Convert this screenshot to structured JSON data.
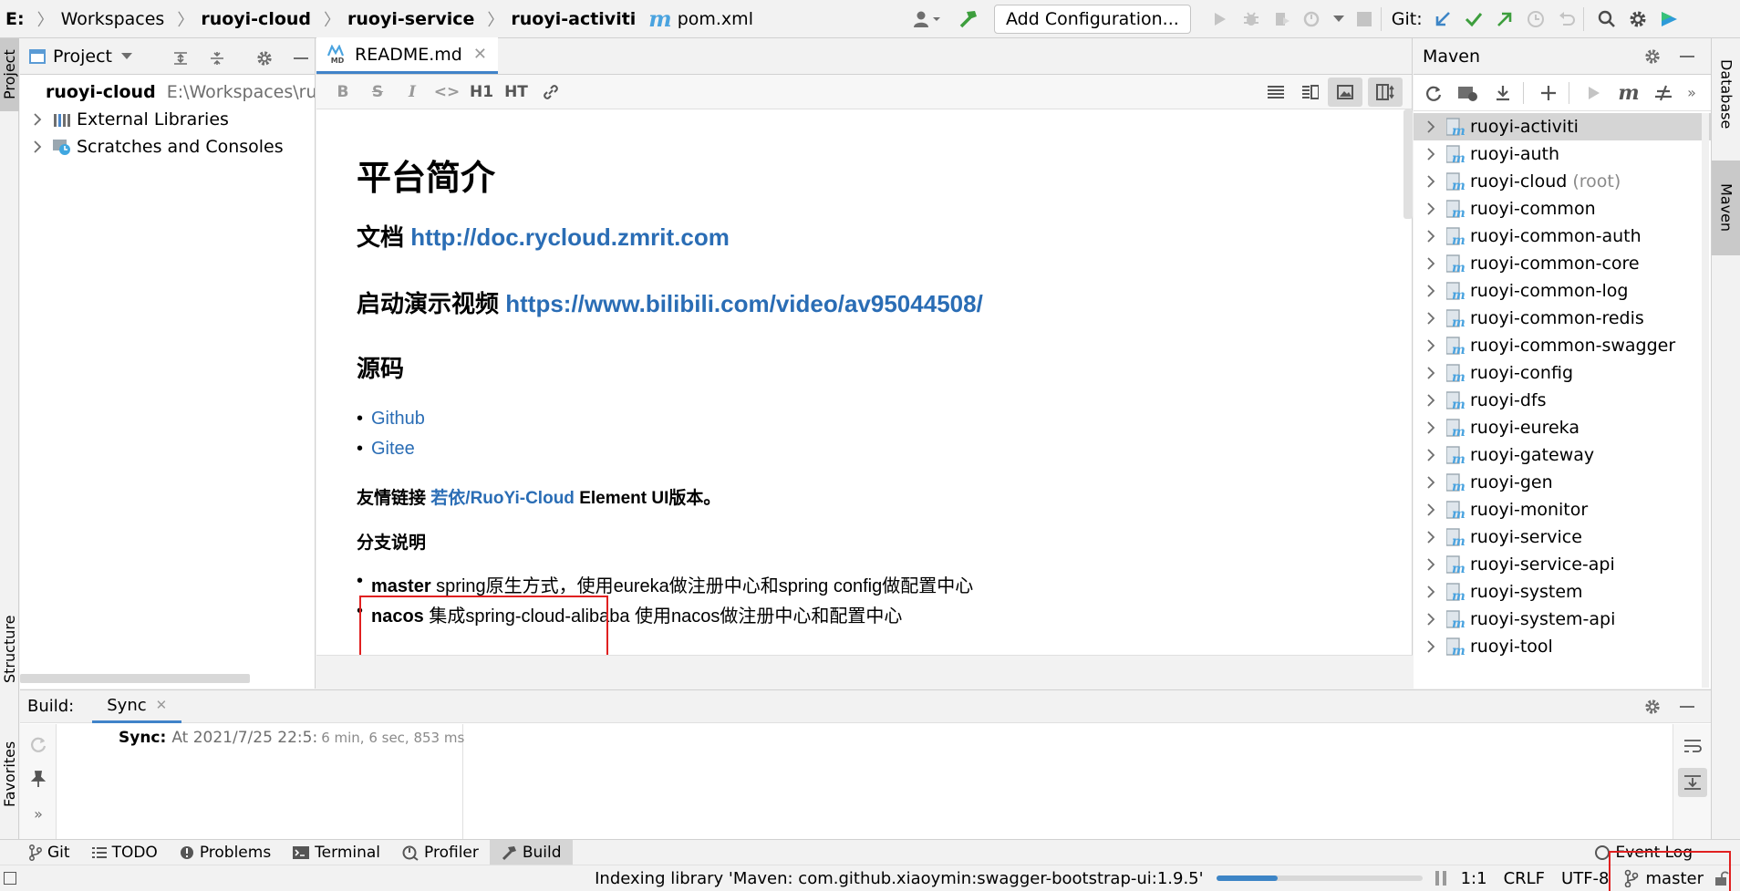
{
  "breadcrumbs": [
    {
      "label": "E:",
      "bold": true
    },
    {
      "label": "Workspaces",
      "bold": false
    },
    {
      "label": "ruoyi-cloud",
      "bold": true
    },
    {
      "label": "ruoyi-service",
      "bold": true
    },
    {
      "label": "ruoyi-activiti",
      "bold": true
    }
  ],
  "current_file": "pom.xml",
  "toolbar": {
    "add_configuration": "Add Configuration...",
    "git_label": "Git:"
  },
  "left_stripe": {
    "project": "Project",
    "structure": "Structure",
    "favorites": "Favorites"
  },
  "right_stripe": {
    "database": "Database",
    "maven": "Maven"
  },
  "project_panel": {
    "title": "Project",
    "items": [
      {
        "label": "ruoyi-cloud",
        "path": "E:\\Workspaces\\ru"
      },
      {
        "label": "External Libraries"
      },
      {
        "label": "Scratches and Consoles"
      }
    ]
  },
  "editor": {
    "tab_label": "README.md",
    "tab_badge": "MD",
    "toolbar_labels": {
      "h1": "H1",
      "ht": "HT"
    },
    "content": {
      "h1": "平台简介",
      "doc_label": "文档",
      "doc_link": "http://doc.rycloud.zmrit.com",
      "video_label": "启动演示视频",
      "video_link": "https://www.bilibili.com/video/av95044508/",
      "source_heading": "源码",
      "source_links": [
        "Github",
        "Gitee"
      ],
      "friend_prefix": "友情链接",
      "friend_link": "若依/RuoYi-Cloud",
      "friend_suffix": "Element UI版本。",
      "branch_heading": "分支说明",
      "branches": [
        {
          "name": "master",
          "desc": "spring原生方式，使用eureka做注册中心和spring config做配置中心"
        },
        {
          "name": "nacos",
          "desc": "集成spring-cloud-alibaba 使用nacos做注册中心和配置中心"
        }
      ]
    }
  },
  "maven_panel": {
    "title": "Maven",
    "modules": [
      {
        "name": "ruoyi-activiti",
        "suffix": ""
      },
      {
        "name": "ruoyi-auth",
        "suffix": ""
      },
      {
        "name": "ruoyi-cloud",
        "suffix": "(root)"
      },
      {
        "name": "ruoyi-common",
        "suffix": ""
      },
      {
        "name": "ruoyi-common-auth",
        "suffix": ""
      },
      {
        "name": "ruoyi-common-core",
        "suffix": ""
      },
      {
        "name": "ruoyi-common-log",
        "suffix": ""
      },
      {
        "name": "ruoyi-common-redis",
        "suffix": ""
      },
      {
        "name": "ruoyi-common-swagger",
        "suffix": ""
      },
      {
        "name": "ruoyi-config",
        "suffix": ""
      },
      {
        "name": "ruoyi-dfs",
        "suffix": ""
      },
      {
        "name": "ruoyi-eureka",
        "suffix": ""
      },
      {
        "name": "ruoyi-gateway",
        "suffix": ""
      },
      {
        "name": "ruoyi-gen",
        "suffix": ""
      },
      {
        "name": "ruoyi-monitor",
        "suffix": ""
      },
      {
        "name": "ruoyi-service",
        "suffix": ""
      },
      {
        "name": "ruoyi-service-api",
        "suffix": ""
      },
      {
        "name": "ruoyi-system",
        "suffix": ""
      },
      {
        "name": "ruoyi-system-api",
        "suffix": ""
      },
      {
        "name": "ruoyi-tool",
        "suffix": ""
      }
    ]
  },
  "build_panel": {
    "label": "Build:",
    "tab": "Sync",
    "sync_title": "Sync:",
    "sync_time": "At 2021/7/25 22:5:",
    "duration": "6 min, 6 sec, 853 ms"
  },
  "bottom_tools": [
    {
      "label": "Git",
      "icon": "git-branch-icon"
    },
    {
      "label": "TODO",
      "icon": "list-icon"
    },
    {
      "label": "Problems",
      "icon": "info-icon"
    },
    {
      "label": "Terminal",
      "icon": "terminal-icon"
    },
    {
      "label": "Profiler",
      "icon": "profiler-icon"
    },
    {
      "label": "Build",
      "icon": "hammer-icon"
    }
  ],
  "event_log": "Event Log",
  "status": {
    "indexing": "Indexing library 'Maven: com.github.xiaoymin:swagger-bootstrap-ui:1.9.5'",
    "indexing_progress": 0.3,
    "position": "1:1",
    "line_sep": "CRLF",
    "encoding": "UTF-8",
    "branch": "master"
  }
}
